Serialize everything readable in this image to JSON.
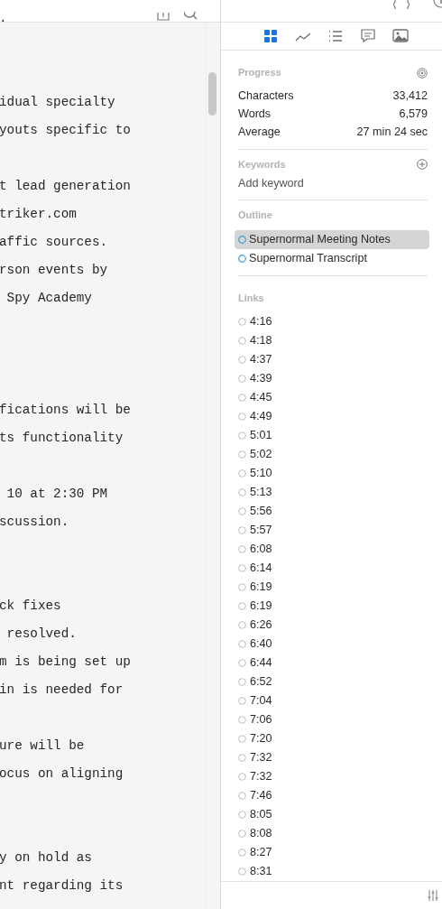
{
  "editor": {
    "paragraphs": [
      [
        "."
      ],
      [
        "idual specialty",
        "youts specific to"
      ],
      [
        "t lead generation",
        "triker.com",
        "affic sources.",
        "rson events by",
        " Spy Academy"
      ],
      [
        "fications will be",
        "ts functionality"
      ],
      [
        " 10 at 2:30 PM",
        "scussion."
      ],
      [
        "ck fixes",
        " resolved.",
        "m is being set up",
        "in is needed for"
      ],
      [
        "ure will be",
        "ocus on aligning"
      ],
      [
        "y on hold as",
        "nt regarding its"
      ]
    ]
  },
  "inspector": {
    "tabs": [
      {
        "kind": "overview",
        "selected": true
      },
      {
        "kind": "chart",
        "selected": false
      },
      {
        "kind": "list",
        "selected": false
      },
      {
        "kind": "comments",
        "selected": false
      },
      {
        "kind": "images",
        "selected": false
      }
    ],
    "progress": {
      "title": "Progress",
      "stats": [
        {
          "label": "Characters",
          "value": "33,412"
        },
        {
          "label": "Words",
          "value": "6,579"
        },
        {
          "label": "Average",
          "value": "27 min 24 sec"
        }
      ]
    },
    "keywords": {
      "title": "Keywords",
      "placeholder": "Add keyword"
    },
    "outline": {
      "title": "Outline",
      "items": [
        {
          "label": "Supernormal Meeting Notes",
          "selected": true
        },
        {
          "label": "Supernormal Transcript",
          "selected": false
        }
      ]
    },
    "links": {
      "title": "Links",
      "items": [
        "4:16",
        "4:18",
        "4:37",
        "4:39",
        "4:45",
        "4:49",
        "5:01",
        "5:02",
        "5:10",
        "5:13",
        "5:56",
        "5:57",
        "6:08",
        "6:14",
        "6:19",
        "6:19",
        "6:26",
        "6:40",
        "6:44",
        "6:52",
        "7:04",
        "7:06",
        "7:20",
        "7:32",
        "7:32",
        "7:46",
        "8:05",
        "8:08",
        "8:27",
        "8:31"
      ]
    }
  }
}
